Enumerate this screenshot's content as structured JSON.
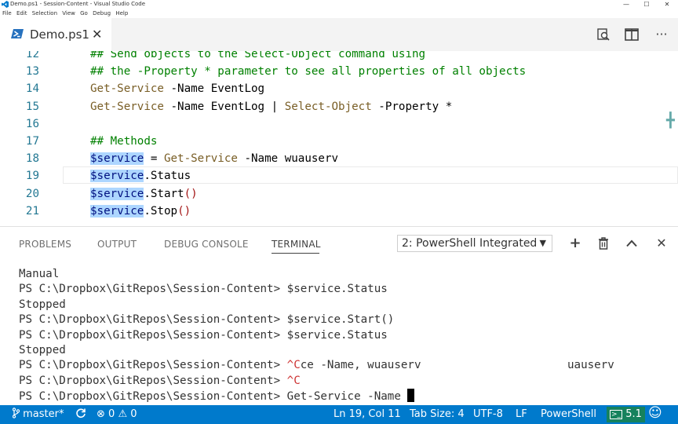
{
  "titlebar": {
    "title": "Demo.ps1 - Session-Content - Visual Studio Code",
    "minimize": "—",
    "maximize": "☐",
    "close": "✕"
  },
  "menu": [
    "File",
    "Edit",
    "Selection",
    "View",
    "Go",
    "Debug",
    "Help"
  ],
  "tab": {
    "label": "Demo.ps1",
    "close": "✕"
  },
  "editor_actions": {
    "open_preview_icon": "search-file-icon",
    "split_editor_icon": "split-editor-icon",
    "more_icon": "more-actions-icon"
  },
  "editor": {
    "lines": [
      {
        "num": "12",
        "tokens": [
          [
            "comment",
            "## Send objects to the Select-Object command using"
          ]
        ]
      },
      {
        "num": "13",
        "tokens": [
          [
            "comment",
            "## the -Property * parameter to see all properties of all objects"
          ]
        ]
      },
      {
        "num": "14",
        "tokens": [
          [
            "cmd",
            "Get-Service"
          ],
          [
            "plain",
            " -Name EventLog"
          ]
        ]
      },
      {
        "num": "15",
        "tokens": [
          [
            "cmd",
            "Get-Service"
          ],
          [
            "plain",
            " -Name EventLog | "
          ],
          [
            "cmd",
            "Select-Object"
          ],
          [
            "plain",
            " -Property *"
          ]
        ]
      },
      {
        "num": "16",
        "tokens": []
      },
      {
        "num": "17",
        "tokens": [
          [
            "comment",
            "## Methods"
          ]
        ]
      },
      {
        "num": "18",
        "tokens": [
          [
            "var",
            "$service"
          ],
          [
            "plain",
            " = "
          ],
          [
            "cmd",
            "Get-Service"
          ],
          [
            "plain",
            " -Name wuauserv"
          ]
        ]
      },
      {
        "num": "19",
        "tokens": [
          [
            "var",
            "$service"
          ],
          [
            "plain",
            ".Status"
          ]
        ]
      },
      {
        "num": "20",
        "tokens": [
          [
            "var",
            "$service"
          ],
          [
            "plain",
            ".Start"
          ],
          [
            "paren",
            "()"
          ]
        ]
      },
      {
        "num": "21",
        "tokens": [
          [
            "var",
            "$service"
          ],
          [
            "plain",
            ".Stop"
          ],
          [
            "paren",
            "()"
          ]
        ]
      }
    ]
  },
  "panel": {
    "tabs": [
      "PROBLEMS",
      "OUTPUT",
      "DEBUG CONSOLE",
      "TERMINAL"
    ],
    "active_tab": "TERMINAL",
    "terminal_select": "2: PowerShell Integrated",
    "select_arrow": "▼",
    "new_terminal": "+",
    "kill_terminal_icon": "trash-icon",
    "maximize": "^",
    "close": "✕"
  },
  "terminal": {
    "lines": [
      {
        "parts": [
          [
            "plain",
            "Manual"
          ]
        ]
      },
      {
        "parts": [
          [
            "plain",
            "PS C:\\Dropbox\\GitRepos\\Session-Content> $service.Status"
          ]
        ]
      },
      {
        "parts": [
          [
            "plain",
            "Stopped"
          ]
        ]
      },
      {
        "parts": [
          [
            "plain",
            "PS C:\\Dropbox\\GitRepos\\Session-Content> $service.Start()"
          ]
        ]
      },
      {
        "parts": [
          [
            "plain",
            "PS C:\\Dropbox\\GitRepos\\Session-Content> $service.Status"
          ]
        ]
      },
      {
        "parts": [
          [
            "plain",
            "Stopped"
          ]
        ]
      },
      {
        "parts": [
          [
            "plain",
            "PS C:\\Dropbox\\GitRepos\\Session-Content> "
          ],
          [
            "red",
            "^C"
          ],
          [
            "plain",
            "ce -Name, wuauserv"
          ]
        ],
        "right": "uauserv"
      },
      {
        "parts": [
          [
            "plain",
            "PS C:\\Dropbox\\GitRepos\\Session-Content> "
          ],
          [
            "red",
            "^C"
          ]
        ]
      },
      {
        "parts": [
          [
            "plain",
            "PS C:\\Dropbox\\GitRepos\\Session-Content> Get-Service -Name "
          ]
        ],
        "cursor": true
      }
    ]
  },
  "statusbar": {
    "branch": "master*",
    "sync_icon": "sync-icon",
    "errors": "0",
    "warnings": "0",
    "position": "Ln 19, Col 11",
    "tab_size": "Tab Size: 4",
    "encoding": "UTF-8",
    "eol": "LF",
    "language": "PowerShell",
    "ps_version": "5.1",
    "feedback_icon": "smiley-icon"
  },
  "colors": {
    "accent": "#007acc",
    "version_badge": "#16825d",
    "comment": "#008000",
    "cmdlet": "#795e26",
    "variable_highlight": "#add6ff",
    "terminal_red": "#cd3131"
  }
}
